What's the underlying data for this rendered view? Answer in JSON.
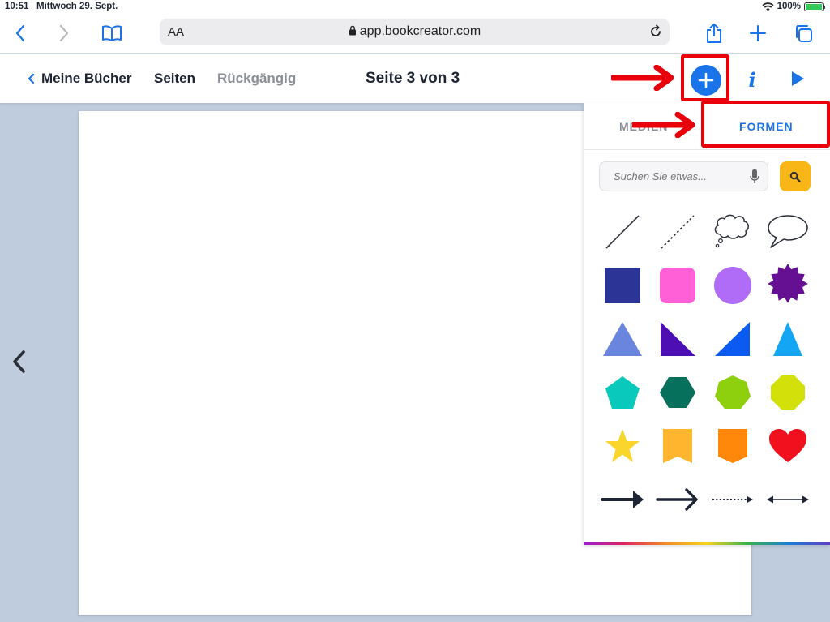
{
  "status_bar": {
    "time": "10:51",
    "date": "Mittwoch 29. Sept.",
    "battery": "100%"
  },
  "safari": {
    "text_size_label": "AA",
    "url": "app.bookcreator.com"
  },
  "app_toolbar": {
    "back_label": "Meine Bücher",
    "pages_label": "Seiten",
    "undo_label": "Rückgängig",
    "page_title": "Seite 3 von 3"
  },
  "panel": {
    "tab_media": "MEDIEN",
    "tab_shapes": "FORMEN",
    "search_placeholder": "Suchen Sie etwas..."
  },
  "colors": {
    "accent": "#1a73e8",
    "search_button": "#f8b617",
    "annotation_red": "#e8000b",
    "canvas_background": "#bfccdd"
  }
}
